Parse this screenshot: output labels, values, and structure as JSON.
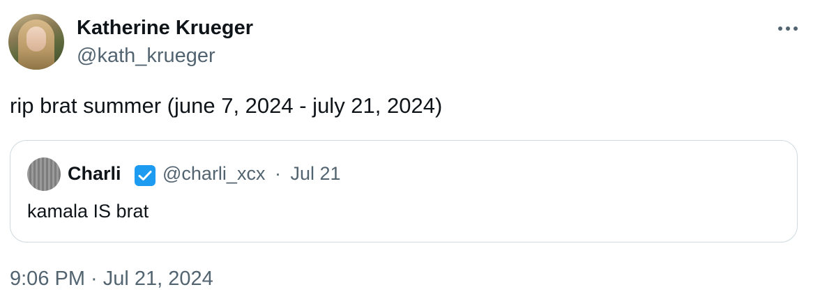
{
  "author": {
    "name": "Katherine Krueger",
    "handle": "@kath_krueger"
  },
  "tweet": {
    "text": "rip brat summer (june 7, 2024 - july 21, 2024)",
    "timestamp": "9:06 PM · Jul 21, 2024"
  },
  "quoted_tweet": {
    "name": "Charli",
    "handle": "@charli_xcx",
    "separator": "·",
    "date": "Jul 21",
    "text": "kamala IS brat",
    "verified_color": "#1d9bf0"
  },
  "icons": {
    "more": "more-horizontal-icon",
    "verified": "verified-badge-icon"
  },
  "colors": {
    "primary_text": "#0f1419",
    "secondary_text": "#536471",
    "border": "#cfd9de"
  }
}
